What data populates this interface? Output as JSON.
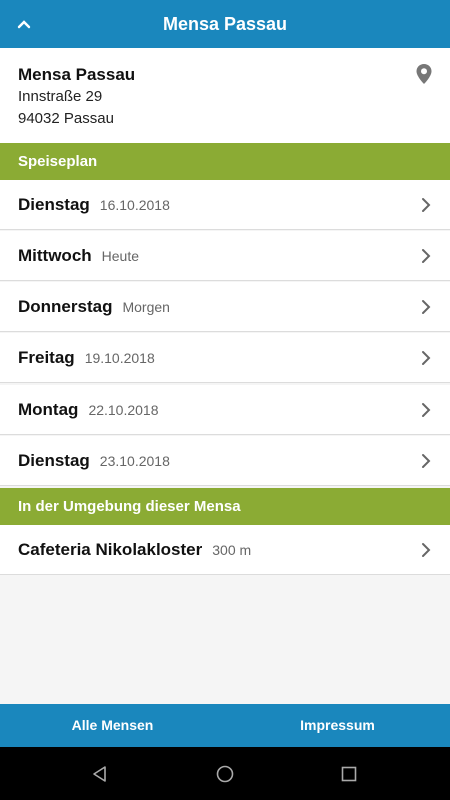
{
  "appbar": {
    "title": "Mensa Passau",
    "back_icon": "chevron-up-icon"
  },
  "address": {
    "name": "Mensa Passau",
    "street": "Innstraße 29",
    "city": "94032 Passau",
    "pin_icon": "location-pin-icon"
  },
  "speiseplan": {
    "title": "Speiseplan",
    "days": [
      {
        "day": "Dienstag",
        "meta": "16.10.2018"
      },
      {
        "day": "Mittwoch",
        "meta": "Heute"
      },
      {
        "day": "Donnerstag",
        "meta": "Morgen"
      },
      {
        "day": "Freitag",
        "meta": "19.10.2018"
      },
      {
        "day": "Montag",
        "meta": "22.10.2018"
      },
      {
        "day": "Dienstag",
        "meta": "23.10.2018"
      }
    ]
  },
  "nearby": {
    "title": "In der Umgebung dieser Mensa",
    "items": [
      {
        "name": "Cafeteria Nikolakloster",
        "distance": "300 m"
      }
    ]
  },
  "bottombar": {
    "left": "Alle Mensen",
    "right": "Impressum"
  },
  "colors": {
    "primary": "#1a87bd",
    "section": "#8bab34",
    "background": "#f5f5f5"
  }
}
